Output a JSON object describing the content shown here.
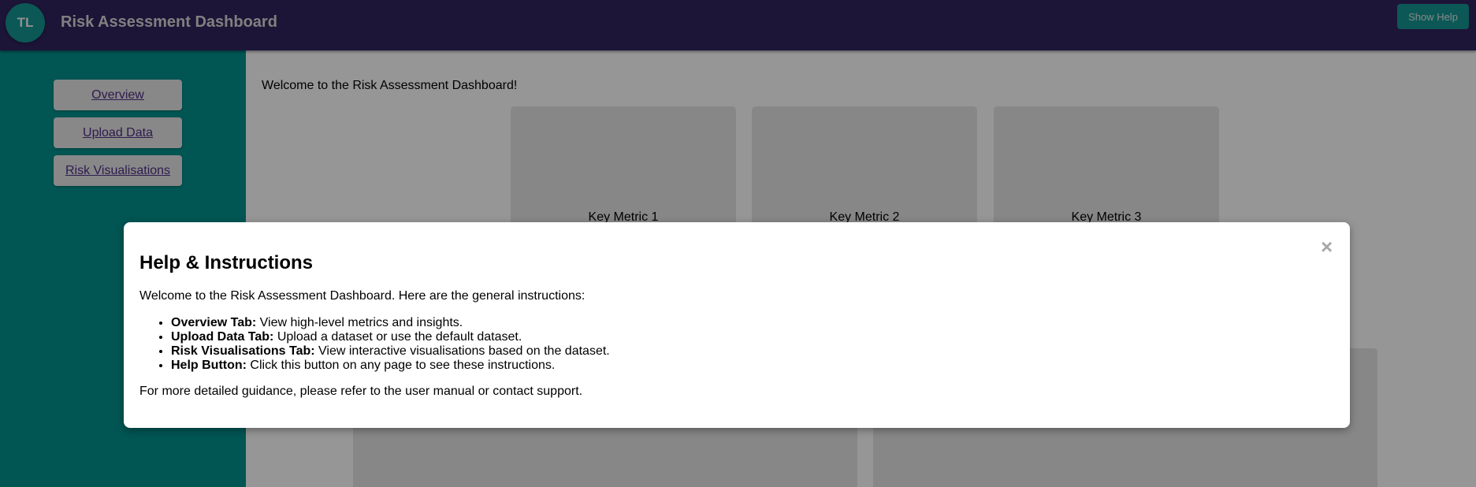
{
  "header": {
    "logo_text": "TL",
    "title": "Risk Assessment Dashboard",
    "help_button": "Show Help",
    "bg_color": "#2e2259",
    "accent_color": "#138f8c"
  },
  "sidebar": {
    "bg_color": "#028a87",
    "items": [
      {
        "label": "Overview"
      },
      {
        "label": "Upload Data"
      },
      {
        "label": "Risk Visualisations"
      }
    ]
  },
  "main": {
    "welcome_text": "Welcome to the Risk Assessment Dashboard!",
    "metrics": [
      {
        "label": "Key Metric 1"
      },
      {
        "label": "Key Metric 2"
      },
      {
        "label": "Key Metric 3"
      }
    ]
  },
  "modal": {
    "close_icon": "close-icon",
    "close_glyph": "×",
    "title": "Help & Instructions",
    "intro": "Welcome to the Risk Assessment Dashboard. Here are the general instructions:",
    "items": [
      {
        "term": "Overview Tab:",
        "text": " View high-level metrics and insights."
      },
      {
        "term": "Upload Data Tab:",
        "text": " Upload a dataset or use the default dataset."
      },
      {
        "term": "Risk Visualisations Tab:",
        "text": " View interactive visualisations based on the dataset."
      },
      {
        "term": "Help Button:",
        "text": " Click this button on any page to see these instructions."
      }
    ],
    "footer": "For more detailed guidance, please refer to the user manual or contact support."
  }
}
